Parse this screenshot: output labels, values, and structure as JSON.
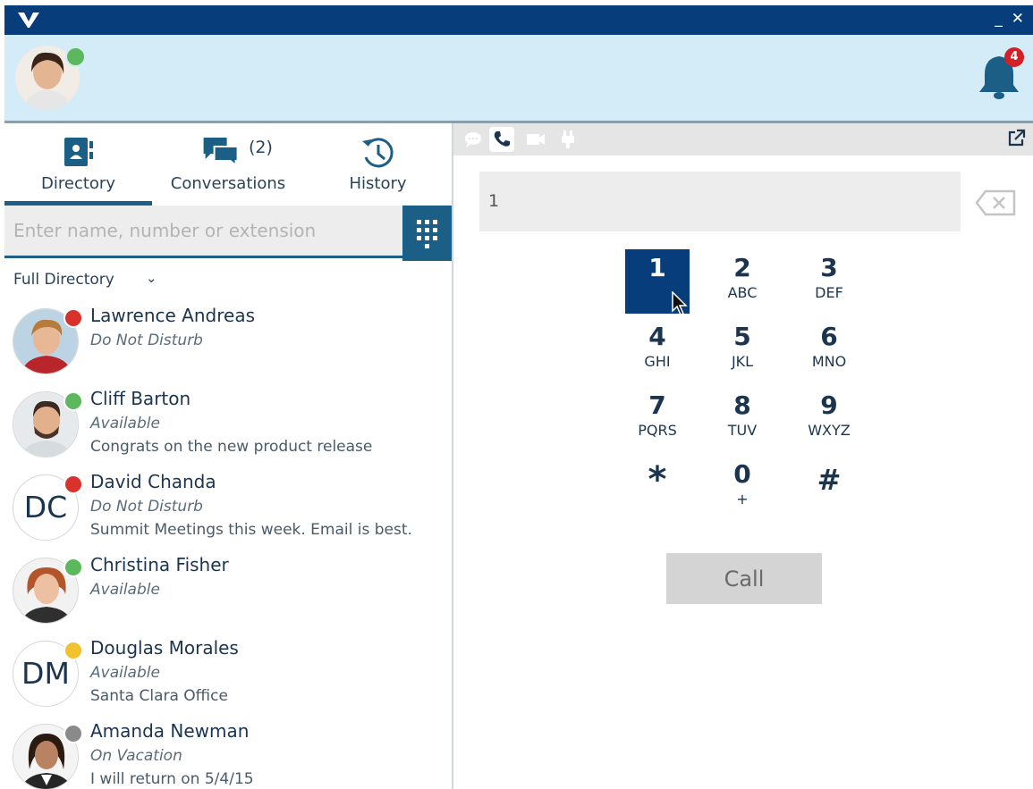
{
  "window": {
    "minimize_label": "_",
    "close_label": "✕"
  },
  "notifications": {
    "count": "4"
  },
  "tabs": [
    {
      "label": "Directory",
      "active": true
    },
    {
      "label": "Conversations",
      "count": "(2)"
    },
    {
      "label": "History"
    }
  ],
  "search": {
    "placeholder": "Enter name, number or extension"
  },
  "directory_filter": {
    "selected": "Full Directory"
  },
  "contacts": [
    {
      "name": "Lawrence Andreas",
      "state": "Do Not Disturb",
      "note": "",
      "status_color": "#d9322c",
      "avatar": "photo"
    },
    {
      "name": "Cliff Barton",
      "state": "Available",
      "note": "Congrats on the new product release",
      "status_color": "#5cb85c",
      "avatar": "photo"
    },
    {
      "name": "David Chanda",
      "state": "Do Not Disturb",
      "note": "Summit Meetings this week. Email is best.",
      "status_color": "#d9322c",
      "avatar": "initials",
      "initials": "DC"
    },
    {
      "name": "Christina Fisher",
      "state": "Available",
      "note": "",
      "status_color": "#5cb85c",
      "avatar": "photo"
    },
    {
      "name": "Douglas Morales",
      "state": "Available",
      "note": "Santa Clara Office",
      "status_color": "#f2c12e",
      "avatar": "initials",
      "initials": "DM"
    },
    {
      "name": "Amanda Newman",
      "state": "On Vacation",
      "note": "I will return on 5/4/15",
      "status_color": "#8a8a8a",
      "avatar": "photo"
    }
  ],
  "dialer": {
    "entered_number": "1",
    "keys": [
      {
        "num": "1",
        "letters": ""
      },
      {
        "num": "2",
        "letters": "ABC"
      },
      {
        "num": "3",
        "letters": "DEF"
      },
      {
        "num": "4",
        "letters": "GHI"
      },
      {
        "num": "5",
        "letters": "JKL"
      },
      {
        "num": "6",
        "letters": "MNO"
      },
      {
        "num": "7",
        "letters": "PQRS"
      },
      {
        "num": "8",
        "letters": "TUV"
      },
      {
        "num": "9",
        "letters": "WXYZ"
      },
      {
        "num": "*",
        "letters": ""
      },
      {
        "num": "0",
        "letters": "+"
      },
      {
        "num": "#",
        "letters": ""
      }
    ],
    "call_label": "Call"
  },
  "colors": {
    "titlebar": "#063d7a",
    "header": "#d4ecf8",
    "accent": "#1c5f86"
  }
}
